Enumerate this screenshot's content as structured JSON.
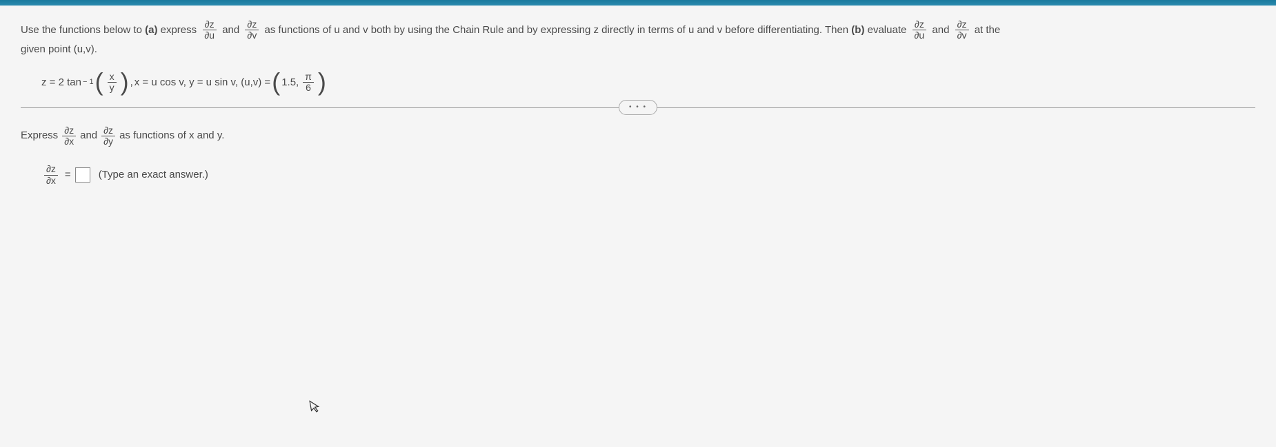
{
  "problem": {
    "intro1": "Use the functions below to ",
    "partA": "(a)",
    "express": " express ",
    "and1": " and ",
    "asFunctions": " as functions of u and v both by using the Chain Rule and by expressing z directly in terms of u and v before differentiating. Then ",
    "partB": "(b)",
    "evaluate": " evaluate ",
    "and2": " and ",
    "atThe": " at the",
    "givenPoint": "given point (u,v)."
  },
  "fracs": {
    "dz": "∂z",
    "du": "∂u",
    "dv": "∂v",
    "dx": "∂x",
    "dy": "∂y"
  },
  "equation": {
    "zEq": "z = 2 tan",
    "supNeg1": "− 1",
    "x": "x",
    "y": "y",
    "comma": ", ",
    "xEq": "x = u cos v, y = u sin v, (u,v) = ",
    "val1": "1.5,",
    "pi": "π",
    "six": "6"
  },
  "subPrompt": {
    "express": "Express ",
    "and": " and ",
    "rest": " as functions of x and y."
  },
  "answer": {
    "equals": " = ",
    "hint": "(Type an exact answer.)"
  },
  "ellipsis": "• • •"
}
